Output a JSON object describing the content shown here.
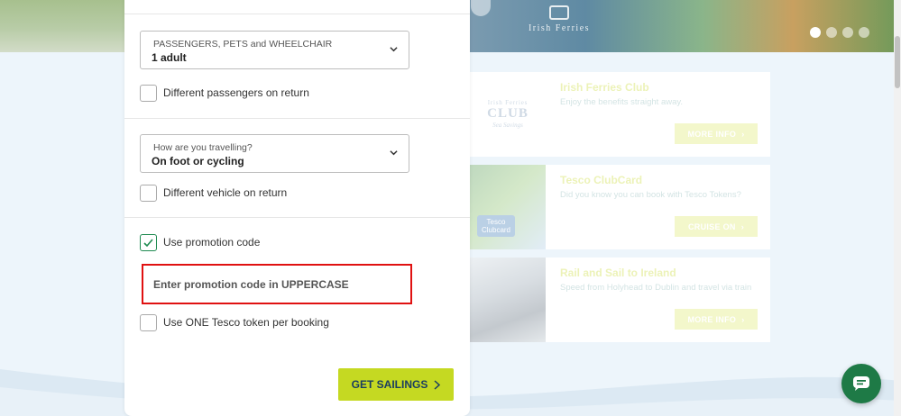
{
  "hero": {
    "brand": "Irish Ferries",
    "slides": 4,
    "active_slide": 1
  },
  "booking": {
    "passengers": {
      "caption": "PASSENGERS, PETS and WHEELCHAIR",
      "value": "1 adult"
    },
    "different_passengers": {
      "label": "Different passengers on return",
      "checked": false
    },
    "travel": {
      "caption": "How are you travelling?",
      "value": "On foot or cycling"
    },
    "different_vehicle": {
      "label": "Different vehicle on return",
      "checked": false
    },
    "promotion": {
      "label": "Use promotion code",
      "checked": true
    },
    "promo_input": {
      "placeholder": "Enter promotion code in UPPERCASE",
      "value": ""
    },
    "tesco_token": {
      "label": "Use ONE Tesco token per booking",
      "checked": false
    },
    "submit_label": "GET SAILINGS"
  },
  "cards": [
    {
      "title": "Irish Ferries Club",
      "desc": "Enjoy the benefits straight away.",
      "button": "MORE INFO",
      "logo_top": "Irish Ferries",
      "logo_big": "CLUB",
      "logo_sub": "Sea Savings"
    },
    {
      "title": "Tesco ClubCard",
      "desc": "Did you know you can book with Tesco Tokens?",
      "button": "CRUISE ON",
      "logo_text": "Tesco Clubcard"
    },
    {
      "title": "Rail and Sail to Ireland",
      "desc": "Speed from Holyhead to Dublin and travel via train",
      "button": "MORE INFO"
    }
  ],
  "colors": {
    "accent": "#c5d922",
    "accent_text": "#1b3e60",
    "check_green": "#1e8a50",
    "error_red": "#e01111",
    "chat": "#1e7a46"
  },
  "icons": {
    "chevron": "chevron-down-icon",
    "check": "check-icon",
    "chat": "chat-icon",
    "arrow": "chevron-right-icon"
  }
}
